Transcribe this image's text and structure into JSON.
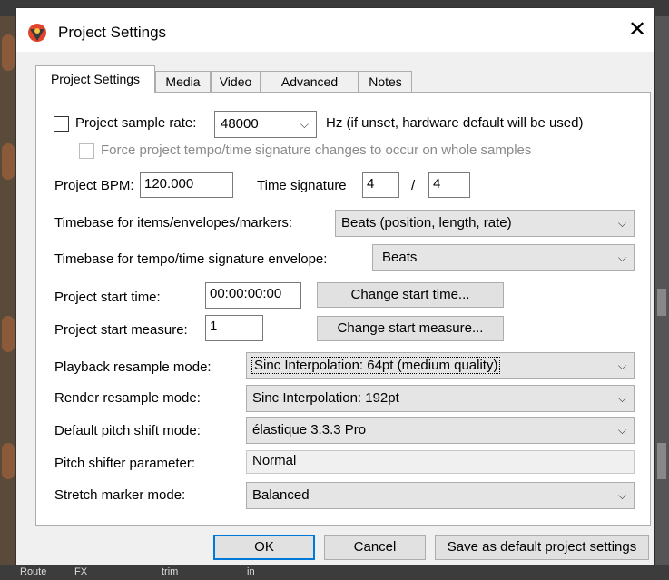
{
  "window": {
    "title": "Project Settings",
    "close_glyph": "✕"
  },
  "tabs": [
    "Project Settings",
    "Media",
    "Video",
    "Advanced",
    "Notes"
  ],
  "sample_rate": {
    "checkbox_label": "Project sample rate:",
    "value": "48000",
    "hint": "Hz (if unset, hardware default will be used)",
    "force_label": "Force project tempo/time signature changes to occur on whole samples"
  },
  "tempo": {
    "bpm_label": "Project BPM:",
    "bpm_value": "120.000",
    "timesig_label": "Time signature",
    "num": "4",
    "sep": "/",
    "den": "4"
  },
  "timebase_items": {
    "label": "Timebase for items/envelopes/markers:",
    "value": "Beats (position, length, rate)"
  },
  "timebase_tempo": {
    "label": "Timebase for tempo/time signature envelope:",
    "value": "Beats"
  },
  "start_time": {
    "label": "Project start time:",
    "value": "00:00:00:00",
    "button": "Change start time..."
  },
  "start_measure": {
    "label": "Project start measure:",
    "value": "1",
    "button": "Change start measure..."
  },
  "playback_resample": {
    "label": "Playback resample mode:",
    "value": "Sinc Interpolation: 64pt (medium quality)"
  },
  "render_resample": {
    "label": "Render resample mode:",
    "value": "Sinc Interpolation: 192pt"
  },
  "pitch_shift": {
    "label": "Default pitch shift mode:",
    "value": "élastique 3.3.3 Pro"
  },
  "pitch_param": {
    "label": "Pitch shifter parameter:",
    "value": "Normal"
  },
  "stretch_marker": {
    "label": "Stretch marker mode:",
    "value": "Balanced"
  },
  "buttons": {
    "ok": "OK",
    "cancel": "Cancel",
    "save_default": "Save as default project settings"
  },
  "background": {
    "bottom_a": "Route",
    "bottom_b": "FX",
    "bottom_c": "trim",
    "bottom_d": "in"
  },
  "colors": {
    "accent": "#0078d7",
    "icon_red": "#e0452c",
    "icon_dark": "#3a3a3a"
  }
}
